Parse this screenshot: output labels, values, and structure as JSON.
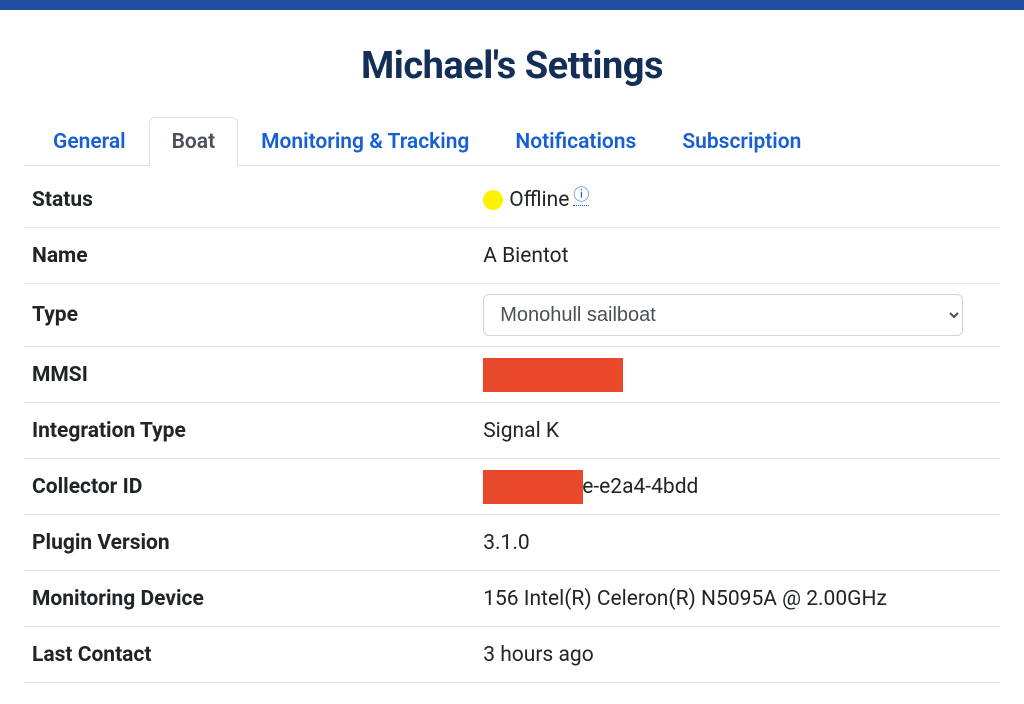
{
  "page": {
    "title": "Michael's Settings"
  },
  "tabs": {
    "general": "General",
    "boat": "Boat",
    "monitoring": "Monitoring & Tracking",
    "notifications": "Notifications",
    "subscription": "Subscription"
  },
  "labels": {
    "status": "Status",
    "name": "Name",
    "type": "Type",
    "mmsi": "MMSI",
    "integration_type": "Integration Type",
    "collector_id": "Collector ID",
    "plugin_version": "Plugin Version",
    "monitoring_device": "Monitoring Device",
    "last_contact": "Last Contact"
  },
  "values": {
    "status": "Offline",
    "name": "A Bientot",
    "type_selected": "Monohull sailboat",
    "mmsi": "",
    "integration_type": "Signal K",
    "collector_id_visible_suffix": "e-e2a4-4bdd",
    "plugin_version": "3.1.0",
    "monitoring_device": "156 Intel(R) Celeron(R) N5095A @ 2.00GHz",
    "last_contact": "3 hours ago"
  },
  "type_options": [
    "Monohull sailboat"
  ],
  "colors": {
    "accent": "#175fd4",
    "heading": "#142f57",
    "banner": "#1f4e9c",
    "status_dot": "#fff200",
    "redaction": "#e8492a"
  }
}
